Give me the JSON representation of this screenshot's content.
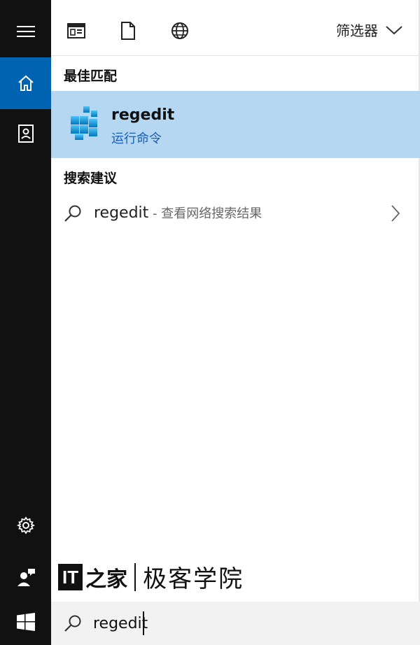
{
  "rail": {
    "items": [
      {
        "icon": "hamburger-menu-icon"
      },
      {
        "icon": "home-icon",
        "active": true
      },
      {
        "icon": "notebook-icon"
      },
      {
        "icon": "gear-icon"
      },
      {
        "icon": "user-feedback-icon"
      },
      {
        "icon": "windows-logo-icon"
      }
    ]
  },
  "topbar": {
    "tabs": [
      {
        "icon": "apps-filter-icon"
      },
      {
        "icon": "documents-filter-icon"
      },
      {
        "icon": "web-filter-icon"
      }
    ],
    "filter_label": "筛选器"
  },
  "best_match": {
    "section_title": "最佳匹配",
    "title": "regedit",
    "subtitle": "运行命令"
  },
  "suggestions": {
    "section_title": "搜索建议",
    "items": [
      {
        "query": "regedit",
        "description": " - 查看网络搜索结果"
      }
    ]
  },
  "watermark": {
    "logo_text": "IT",
    "logo_glyph": "之家",
    "text": "极客学院"
  },
  "search": {
    "value": "regedit"
  },
  "colors": {
    "rail_bg": "#111111",
    "rail_active": "#0063b1",
    "best_match_bg": "#b5d7f2",
    "subtitle_blue": "#1a5fb4"
  }
}
